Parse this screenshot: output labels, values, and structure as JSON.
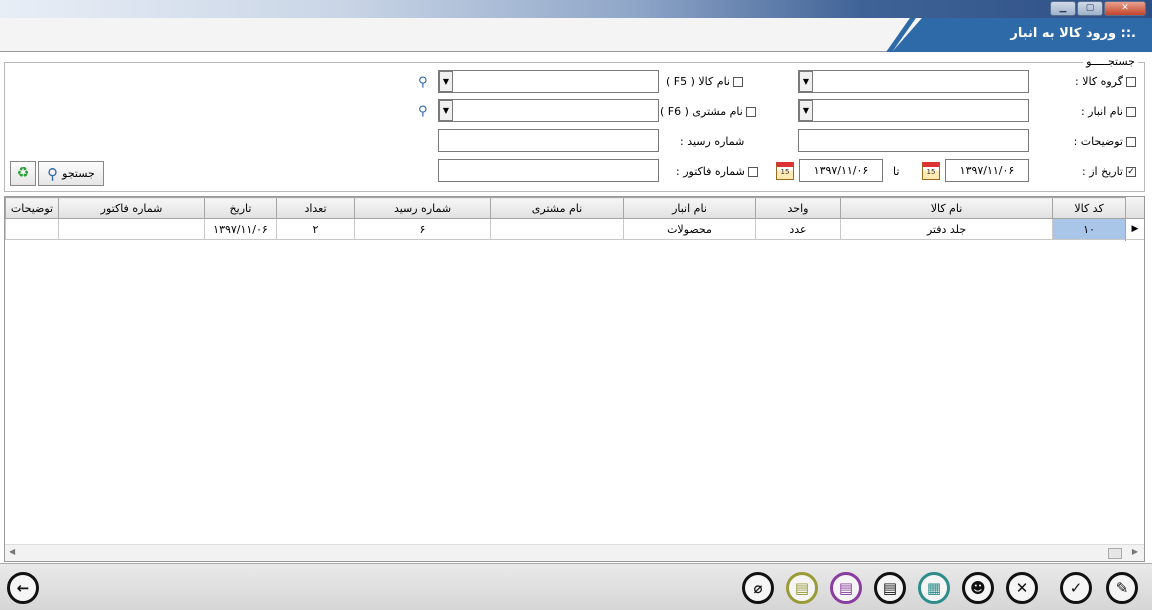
{
  "window": {
    "minimize": "▁",
    "maximize": "▢",
    "close": "✕"
  },
  "header": {
    "title": ".:: ورود کالا به انبار"
  },
  "search": {
    "legend": "جستجـــــو",
    "product_group_label": "گروه کالا :",
    "warehouse_label": "نام انبار :",
    "description_label": "توضیحات :",
    "date_from_label": "تاریخ از :",
    "date_from_value": "۱۳۹۷/۱۱/۰۶",
    "date_to_label": "تا",
    "date_to_value": "۱۳۹۷/۱۱/۰۶",
    "product_name_label": "نام کالا ( F5 )",
    "customer_name_label": "نام مشتری ( F6 )",
    "receipt_number_label": "شماره رسید :",
    "invoice_number_label": "شماره فاکتور :",
    "calendar_day": "15",
    "search_button": "جستجو",
    "date_checked": "✓"
  },
  "grid": {
    "columns": [
      "توضیحات",
      "شماره فاکتور",
      "تاریخ",
      "تعداد",
      "شماره رسید",
      "نام مشتری",
      "نام انبار",
      "واحد",
      "نام کالا",
      "کد کالا"
    ],
    "rows": [
      [
        "",
        "",
        "۱۳۹۷/۱۱/۰۶",
        "۲",
        "۶",
        "",
        "محصولات",
        "عدد",
        "جلد دفتر",
        "۱۰"
      ]
    ],
    "row_marker": "▶"
  },
  "footer": {
    "icons": [
      "back-icon",
      "attachment-icon",
      "print-olive-icon",
      "print-purple-icon",
      "print-icon",
      "report-icon",
      "user-icon",
      "delete-icon",
      "confirm-icon",
      "edit-icon"
    ]
  }
}
